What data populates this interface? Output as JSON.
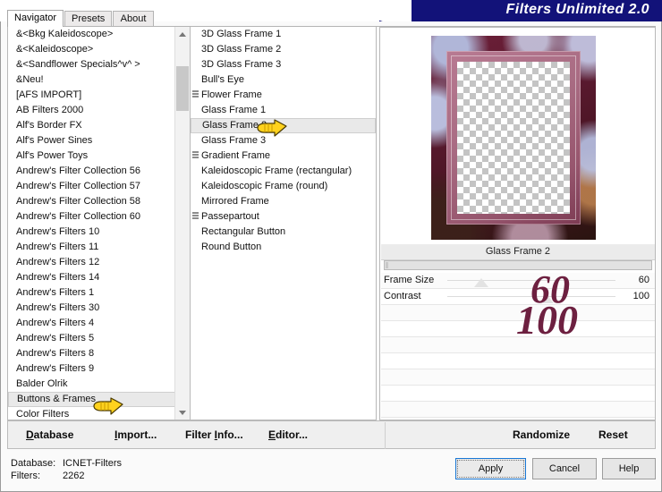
{
  "window": {
    "title": "Filters Unlimited 2.0"
  },
  "tabs": [
    {
      "label": "Navigator",
      "active": true
    },
    {
      "label": "Presets",
      "active": false
    },
    {
      "label": "About",
      "active": false
    }
  ],
  "left_list": {
    "selected": "Buttons & Frames",
    "items": [
      {
        "label": "&<Bkg Kaleidoscope>"
      },
      {
        "label": "&<Kaleidoscope>"
      },
      {
        "label": "&<Sandflower Specials^v^ >"
      },
      {
        "label": "&Neu!"
      },
      {
        "label": "[AFS IMPORT]"
      },
      {
        "label": "AB Filters 2000"
      },
      {
        "label": "Alf's Border FX"
      },
      {
        "label": "Alf's Power Sines"
      },
      {
        "label": "Alf's Power Toys"
      },
      {
        "label": "Andrew's Filter Collection 56"
      },
      {
        "label": "Andrew's Filter Collection 57"
      },
      {
        "label": "Andrew's Filter Collection 58"
      },
      {
        "label": "Andrew's Filter Collection 60"
      },
      {
        "label": "Andrew's Filters 10"
      },
      {
        "label": "Andrew's Filters 11"
      },
      {
        "label": "Andrew's Filters 12"
      },
      {
        "label": "Andrew's Filters 14"
      },
      {
        "label": "Andrew's Filters 1"
      },
      {
        "label": "Andrew's Filters 30"
      },
      {
        "label": "Andrew's Filters 4"
      },
      {
        "label": "Andrew's Filters 5"
      },
      {
        "label": "Andrew's Filters 8"
      },
      {
        "label": "Andrew's Filters 9"
      },
      {
        "label": "Balder Olrik"
      },
      {
        "label": "Buttons & Frames"
      },
      {
        "label": "Color Filters"
      }
    ]
  },
  "mid_list": {
    "selected": "Glass Frame 2",
    "items": [
      {
        "label": "3D Glass Frame 1",
        "icon": false
      },
      {
        "label": "3D Glass Frame 2",
        "icon": false
      },
      {
        "label": "3D Glass Frame 3",
        "icon": false
      },
      {
        "label": "Bull's Eye",
        "icon": false
      },
      {
        "label": "Flower Frame",
        "icon": true
      },
      {
        "label": "Glass Frame 1",
        "icon": false
      },
      {
        "label": "Glass Frame 2",
        "icon": false
      },
      {
        "label": "Glass Frame 3",
        "icon": false
      },
      {
        "label": "Gradient Frame",
        "icon": true
      },
      {
        "label": "Kaleidoscopic Frame (rectangular)",
        "icon": false
      },
      {
        "label": "Kaleidoscopic Frame (round)",
        "icon": false
      },
      {
        "label": "Mirrored Frame",
        "icon": false
      },
      {
        "label": "Passepartout",
        "icon": true
      },
      {
        "label": "Rectangular Button",
        "icon": false
      },
      {
        "label": "Round Button",
        "icon": false
      }
    ]
  },
  "preview": {
    "effect_title": "Glass Frame 2"
  },
  "parameters": {
    "rows": [
      {
        "label": "Frame Size",
        "value": "60",
        "pos": 34
      },
      {
        "label": "Contrast",
        "value": "100",
        "pos": 58
      },
      {
        "label": "",
        "value": "",
        "pos": -1
      },
      {
        "label": "",
        "value": "",
        "pos": -1
      },
      {
        "label": "",
        "value": "",
        "pos": -1
      },
      {
        "label": "",
        "value": "",
        "pos": -1
      },
      {
        "label": "",
        "value": "",
        "pos": -1
      },
      {
        "label": "",
        "value": "",
        "pos": -1
      },
      {
        "label": "",
        "value": "",
        "pos": -1
      },
      {
        "label": "",
        "value": "",
        "pos": -1
      }
    ]
  },
  "annotations": {
    "frame_size_value": "60",
    "contrast_value": "100",
    "color": "#6d2040"
  },
  "toolbar": {
    "database": "Database",
    "import": "Import...",
    "filter_info": "Filter Info...",
    "editor": "Editor...",
    "randomize": "Randomize",
    "reset": "Reset"
  },
  "status": {
    "database_label": "Database:",
    "database_value": "ICNET-Filters",
    "filters_label": "Filters:",
    "filters_value": "2262"
  },
  "buttons": {
    "apply": "Apply",
    "cancel": "Cancel",
    "help": "Help"
  }
}
